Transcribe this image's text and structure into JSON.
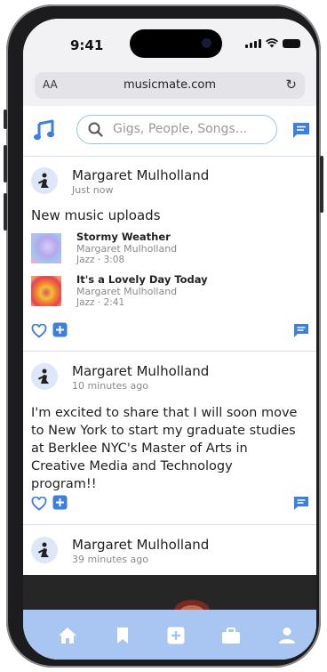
{
  "status_bar": {
    "time": "9:41"
  },
  "browser": {
    "text_size_label": "AA",
    "url": "musicmate.com",
    "reload_icon": "reload-icon"
  },
  "header": {
    "logo_icon": "music-note-icon",
    "search_placeholder": "Gigs, People, Songs...",
    "messages_icon": "message-icon"
  },
  "colors": {
    "accent": "#3d7fe0",
    "tab_bar": "#a9c6f2",
    "search_border": "#9ec0ef",
    "divider": "#d6dff0"
  },
  "feed": {
    "posts": [
      {
        "author": "Margaret Mulholland",
        "time": "Just now",
        "text": "New music uploads",
        "tracks": [
          {
            "title": "Stormy Weather",
            "artist": "Margaret Mulholland",
            "meta": "Jazz · 3:08"
          },
          {
            "title": "It's a Lovely Day Today",
            "artist": "Margaret Mulholland",
            "meta": "Jazz · 2:41"
          }
        ]
      },
      {
        "author": "Margaret Mulholland",
        "time": "10 minutes ago",
        "text": "I'm excited to share that I will soon move to New York to start my graduate studies at Berklee NYC's Master of Arts in Creative Media and Technology program!!"
      },
      {
        "author": "Margaret Mulholland",
        "time": "39 minutes ago"
      }
    ]
  },
  "tab_bar": {
    "items": [
      "home-icon",
      "bookmark-icon",
      "add-icon",
      "briefcase-icon",
      "profile-icon"
    ]
  }
}
